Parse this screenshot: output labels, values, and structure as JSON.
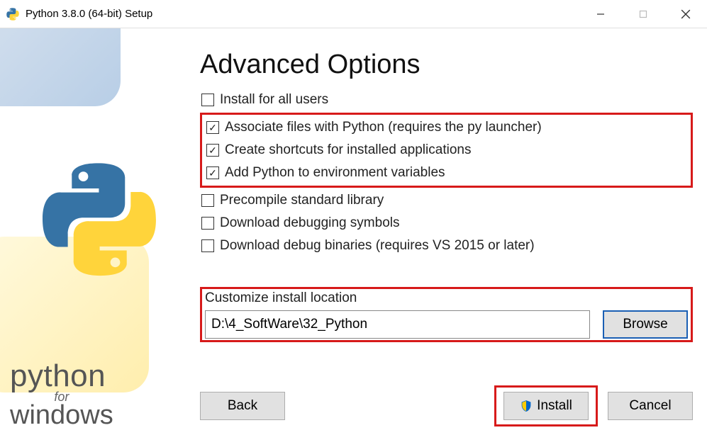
{
  "window": {
    "title": "Python 3.8.0 (64-bit) Setup"
  },
  "heading": "Advanced Options",
  "options": {
    "install_all_users": "Install for all users",
    "associate_files": "Associate files with Python (requires the py launcher)",
    "create_shortcuts": "Create shortcuts for installed applications",
    "add_to_env": "Add Python to environment variables",
    "precompile": "Precompile standard library",
    "download_debug_symbols": "Download debugging symbols",
    "download_debug_binaries": "Download debug binaries (requires VS 2015 or later)"
  },
  "checked": {
    "install_all_users": false,
    "associate_files": true,
    "create_shortcuts": true,
    "add_to_env": true,
    "precompile": false,
    "download_debug_symbols": false,
    "download_debug_binaries": false
  },
  "location": {
    "label": "Customize install location",
    "value": "D:\\4_SoftWare\\32_Python",
    "browse": "Browse"
  },
  "buttons": {
    "back": "Back",
    "install": "Install",
    "cancel": "Cancel"
  },
  "brand": {
    "line1": "python",
    "line2": "for",
    "line3": "windows"
  }
}
